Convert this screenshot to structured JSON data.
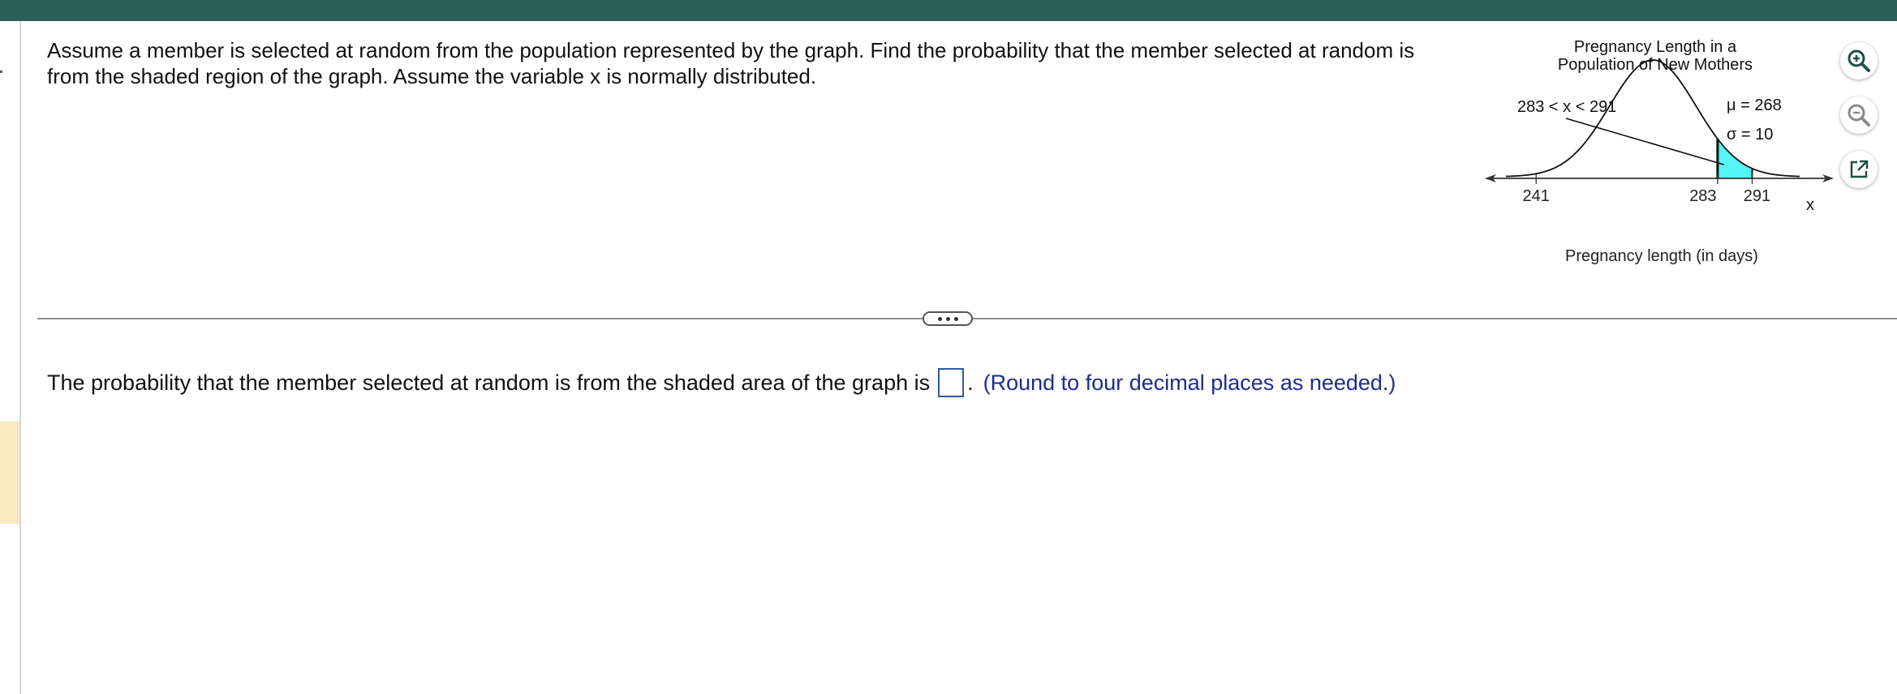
{
  "question": {
    "line1": "Assume a member is selected at random from the population represented by the graph. Find the probability that the member selected at random is",
    "line2": "from the shaded region of the graph. Assume the variable x is normally distributed."
  },
  "figure": {
    "title_line1": "Pregnancy Length in a",
    "title_line2": "Population of New Mothers",
    "region_label": "283 < x < 291",
    "mu_label": "μ = 268",
    "sigma_label": "σ = 10",
    "axis_var": "x",
    "tick_labels": [
      "241",
      "283",
      "291"
    ],
    "xlabel": "Pregnancy length (in days)",
    "shade_color": "#55f4f7"
  },
  "tools": {
    "zoom_in_icon": "zoom-in-icon",
    "zoom_out_icon": "zoom-out-icon",
    "popout_icon": "popout-icon"
  },
  "answer": {
    "prefix": "The probability that the member selected at random is from the shaded area of the graph is",
    "value": "",
    "suffix": ".",
    "hint": "(Round to four decimal places as needed.)"
  },
  "colors": {
    "header_bar": "#2a5e58",
    "hint_text": "#1f2c8f",
    "left_marker": "#faeac0"
  },
  "chart_data": {
    "type": "area",
    "title": "Pregnancy Length in a Population of New Mothers",
    "xlabel": "Pregnancy length (in days)",
    "ylabel": "",
    "mean": 268,
    "sd": 10,
    "shaded_interval": [
      283,
      291
    ],
    "x_ticks": [
      241,
      283,
      291
    ],
    "xlim": [
      231,
      308
    ]
  }
}
